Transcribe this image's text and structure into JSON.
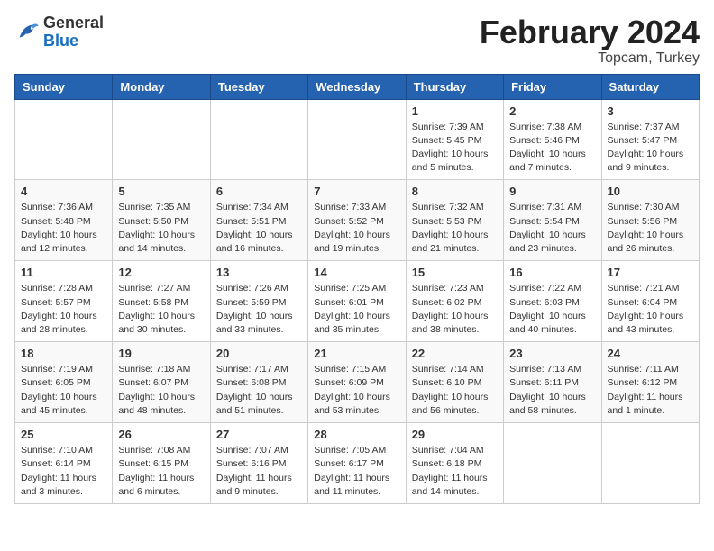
{
  "header": {
    "logo_general": "General",
    "logo_blue": "Blue",
    "month_title": "February 2024",
    "location": "Topcam, Turkey"
  },
  "weekdays": [
    "Sunday",
    "Monday",
    "Tuesday",
    "Wednesday",
    "Thursday",
    "Friday",
    "Saturday"
  ],
  "weeks": [
    [
      {
        "day": "",
        "info": ""
      },
      {
        "day": "",
        "info": ""
      },
      {
        "day": "",
        "info": ""
      },
      {
        "day": "",
        "info": ""
      },
      {
        "day": "1",
        "info": "Sunrise: 7:39 AM\nSunset: 5:45 PM\nDaylight: 10 hours\nand 5 minutes."
      },
      {
        "day": "2",
        "info": "Sunrise: 7:38 AM\nSunset: 5:46 PM\nDaylight: 10 hours\nand 7 minutes."
      },
      {
        "day": "3",
        "info": "Sunrise: 7:37 AM\nSunset: 5:47 PM\nDaylight: 10 hours\nand 9 minutes."
      }
    ],
    [
      {
        "day": "4",
        "info": "Sunrise: 7:36 AM\nSunset: 5:48 PM\nDaylight: 10 hours\nand 12 minutes."
      },
      {
        "day": "5",
        "info": "Sunrise: 7:35 AM\nSunset: 5:50 PM\nDaylight: 10 hours\nand 14 minutes."
      },
      {
        "day": "6",
        "info": "Sunrise: 7:34 AM\nSunset: 5:51 PM\nDaylight: 10 hours\nand 16 minutes."
      },
      {
        "day": "7",
        "info": "Sunrise: 7:33 AM\nSunset: 5:52 PM\nDaylight: 10 hours\nand 19 minutes."
      },
      {
        "day": "8",
        "info": "Sunrise: 7:32 AM\nSunset: 5:53 PM\nDaylight: 10 hours\nand 21 minutes."
      },
      {
        "day": "9",
        "info": "Sunrise: 7:31 AM\nSunset: 5:54 PM\nDaylight: 10 hours\nand 23 minutes."
      },
      {
        "day": "10",
        "info": "Sunrise: 7:30 AM\nSunset: 5:56 PM\nDaylight: 10 hours\nand 26 minutes."
      }
    ],
    [
      {
        "day": "11",
        "info": "Sunrise: 7:28 AM\nSunset: 5:57 PM\nDaylight: 10 hours\nand 28 minutes."
      },
      {
        "day": "12",
        "info": "Sunrise: 7:27 AM\nSunset: 5:58 PM\nDaylight: 10 hours\nand 30 minutes."
      },
      {
        "day": "13",
        "info": "Sunrise: 7:26 AM\nSunset: 5:59 PM\nDaylight: 10 hours\nand 33 minutes."
      },
      {
        "day": "14",
        "info": "Sunrise: 7:25 AM\nSunset: 6:01 PM\nDaylight: 10 hours\nand 35 minutes."
      },
      {
        "day": "15",
        "info": "Sunrise: 7:23 AM\nSunset: 6:02 PM\nDaylight: 10 hours\nand 38 minutes."
      },
      {
        "day": "16",
        "info": "Sunrise: 7:22 AM\nSunset: 6:03 PM\nDaylight: 10 hours\nand 40 minutes."
      },
      {
        "day": "17",
        "info": "Sunrise: 7:21 AM\nSunset: 6:04 PM\nDaylight: 10 hours\nand 43 minutes."
      }
    ],
    [
      {
        "day": "18",
        "info": "Sunrise: 7:19 AM\nSunset: 6:05 PM\nDaylight: 10 hours\nand 45 minutes."
      },
      {
        "day": "19",
        "info": "Sunrise: 7:18 AM\nSunset: 6:07 PM\nDaylight: 10 hours\nand 48 minutes."
      },
      {
        "day": "20",
        "info": "Sunrise: 7:17 AM\nSunset: 6:08 PM\nDaylight: 10 hours\nand 51 minutes."
      },
      {
        "day": "21",
        "info": "Sunrise: 7:15 AM\nSunset: 6:09 PM\nDaylight: 10 hours\nand 53 minutes."
      },
      {
        "day": "22",
        "info": "Sunrise: 7:14 AM\nSunset: 6:10 PM\nDaylight: 10 hours\nand 56 minutes."
      },
      {
        "day": "23",
        "info": "Sunrise: 7:13 AM\nSunset: 6:11 PM\nDaylight: 10 hours\nand 58 minutes."
      },
      {
        "day": "24",
        "info": "Sunrise: 7:11 AM\nSunset: 6:12 PM\nDaylight: 11 hours\nand 1 minute."
      }
    ],
    [
      {
        "day": "25",
        "info": "Sunrise: 7:10 AM\nSunset: 6:14 PM\nDaylight: 11 hours\nand 3 minutes."
      },
      {
        "day": "26",
        "info": "Sunrise: 7:08 AM\nSunset: 6:15 PM\nDaylight: 11 hours\nand 6 minutes."
      },
      {
        "day": "27",
        "info": "Sunrise: 7:07 AM\nSunset: 6:16 PM\nDaylight: 11 hours\nand 9 minutes."
      },
      {
        "day": "28",
        "info": "Sunrise: 7:05 AM\nSunset: 6:17 PM\nDaylight: 11 hours\nand 11 minutes."
      },
      {
        "day": "29",
        "info": "Sunrise: 7:04 AM\nSunset: 6:18 PM\nDaylight: 11 hours\nand 14 minutes."
      },
      {
        "day": "",
        "info": ""
      },
      {
        "day": "",
        "info": ""
      }
    ]
  ]
}
